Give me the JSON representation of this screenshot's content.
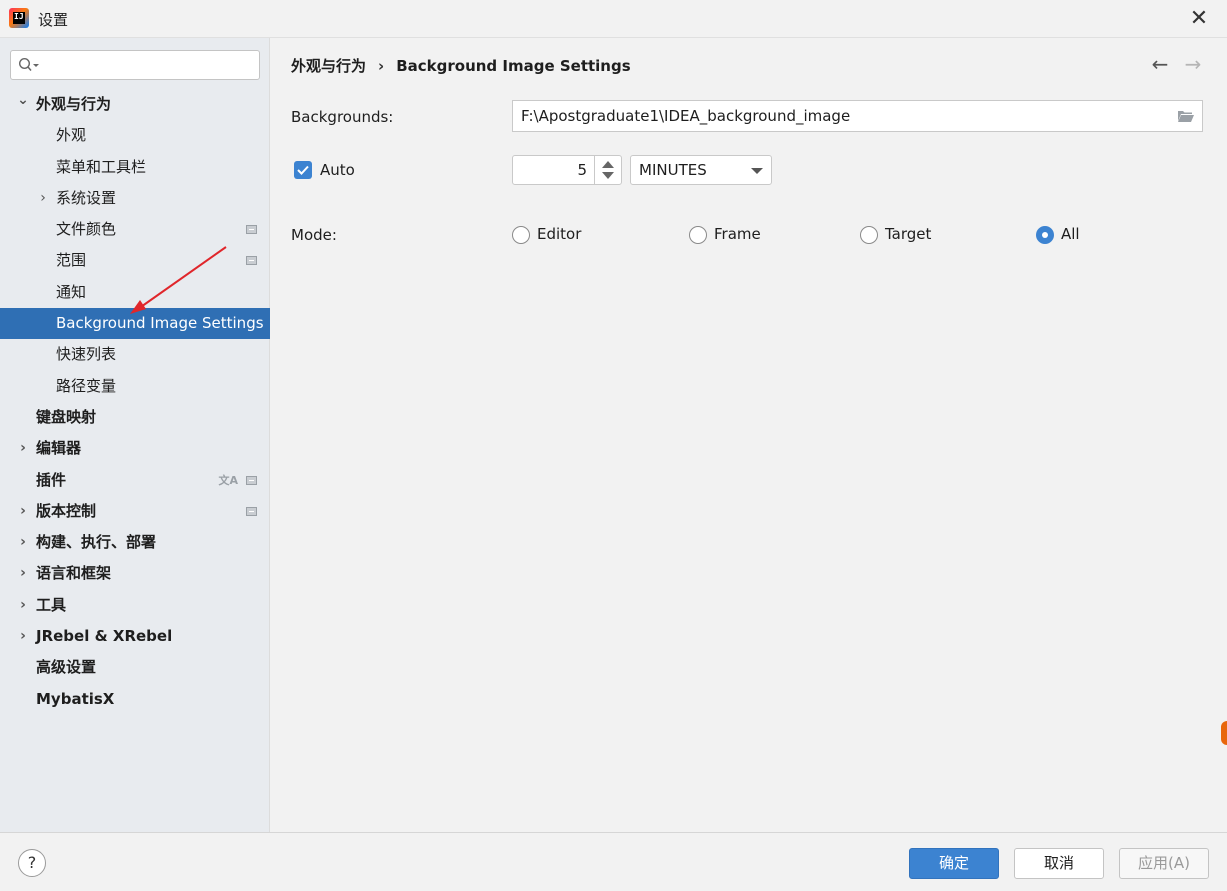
{
  "window": {
    "title": "设置",
    "app_logo_text": "IJ"
  },
  "search": {
    "placeholder": "",
    "value": ""
  },
  "sidebar": {
    "items": [
      {
        "label": "外观与行为",
        "level": 0,
        "bold": true,
        "expanded": true,
        "arrow": "down"
      },
      {
        "label": "外观",
        "level": 1
      },
      {
        "label": "菜单和工具栏",
        "level": 1
      },
      {
        "label": "系统设置",
        "level": 1,
        "arrow": "right"
      },
      {
        "label": "文件颜色",
        "level": 1,
        "marker": true
      },
      {
        "label": "范围",
        "level": 1,
        "marker": true
      },
      {
        "label": "通知",
        "level": 1
      },
      {
        "label": "Background Image Settings",
        "level": 1,
        "selected": true
      },
      {
        "label": "快速列表",
        "level": 1
      },
      {
        "label": "路径变量",
        "level": 1
      },
      {
        "label": "键盘映射",
        "level": 0,
        "bold": true
      },
      {
        "label": "编辑器",
        "level": 0,
        "bold": true,
        "arrow": "right"
      },
      {
        "label": "插件",
        "level": 0,
        "bold": true,
        "marker": true,
        "translate_icon": true
      },
      {
        "label": "版本控制",
        "level": 0,
        "bold": true,
        "arrow": "right",
        "marker": true
      },
      {
        "label": "构建、执行、部署",
        "level": 0,
        "bold": true,
        "arrow": "right"
      },
      {
        "label": "语言和框架",
        "level": 0,
        "bold": true,
        "arrow": "right"
      },
      {
        "label": "工具",
        "level": 0,
        "bold": true,
        "arrow": "right"
      },
      {
        "label": "JRebel & XRebel",
        "level": 0,
        "bold": true,
        "arrow": "right"
      },
      {
        "label": "高级设置",
        "level": 0,
        "bold": true
      },
      {
        "label": "MybatisX",
        "level": 0,
        "bold": true
      }
    ]
  },
  "breadcrumb": {
    "parent": "外观与行为",
    "separator": "›",
    "current": "Background Image Settings"
  },
  "nav": {
    "back": "←",
    "forward": "→"
  },
  "form": {
    "backgrounds_label": "Backgrounds:",
    "backgrounds_value": "F:\\Apostgraduate1\\IDEA_background_image",
    "auto_label": "Auto",
    "auto_checked": true,
    "interval_value": "5",
    "unit_value": "MINUTES",
    "mode_label": "Mode:",
    "mode_options": [
      {
        "label": "Editor",
        "checked": false
      },
      {
        "label": "Frame",
        "checked": false
      },
      {
        "label": "Target",
        "checked": false
      },
      {
        "label": "All",
        "checked": true
      }
    ]
  },
  "footer": {
    "help": "?",
    "ok": "确定",
    "cancel": "取消",
    "apply": "应用(A)"
  },
  "colors": {
    "selected_bg": "#2f6fb4",
    "accent": "#3c83d1",
    "sidebar_bg": "#e8ebef",
    "content_bg": "#f2f2f2"
  }
}
